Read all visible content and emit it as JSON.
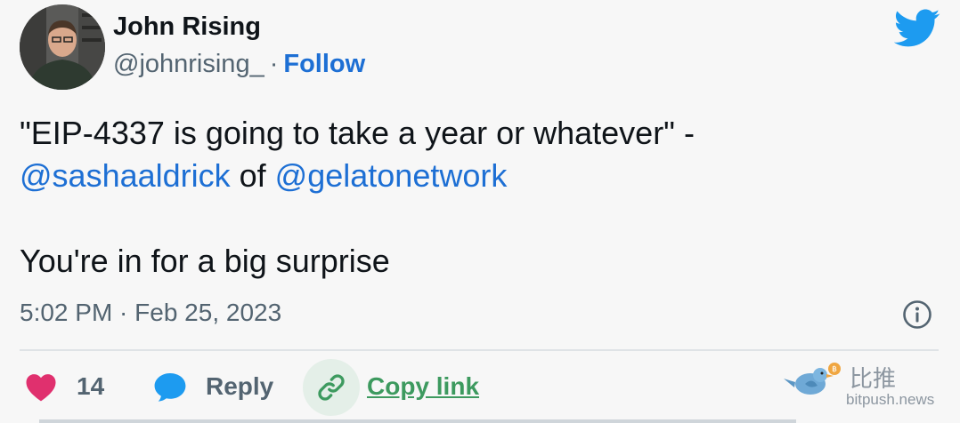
{
  "author": {
    "name": "John Rising",
    "handle": "@johnrising_",
    "separator": "·",
    "follow_label": "Follow"
  },
  "tweet": {
    "line1": "\"EIP-4337 is going to take a year or whatever\" -",
    "mention1": "@sashaaldrick",
    "connector": " of ",
    "mention2": "@gelatonetwork",
    "line3": "You're in for a big surprise",
    "timestamp": "5:02 PM · Feb 25, 2023"
  },
  "actions": {
    "like_count": "14",
    "reply_label": "Reply",
    "copy_link_label": "Copy link"
  },
  "watermark": {
    "brand_cn": "比推",
    "url": "bitpush.news"
  },
  "colors": {
    "link_blue": "#1d6fd4",
    "twitter_blue": "#1d9bf0",
    "heart_pink": "#e0306e",
    "copy_green": "#3d9a5f",
    "muted_gray": "#536471"
  },
  "icons": [
    "twitter-bird-icon",
    "info-icon",
    "heart-icon",
    "reply-bubble-icon",
    "link-icon",
    "bitpush-bird-icon"
  ]
}
